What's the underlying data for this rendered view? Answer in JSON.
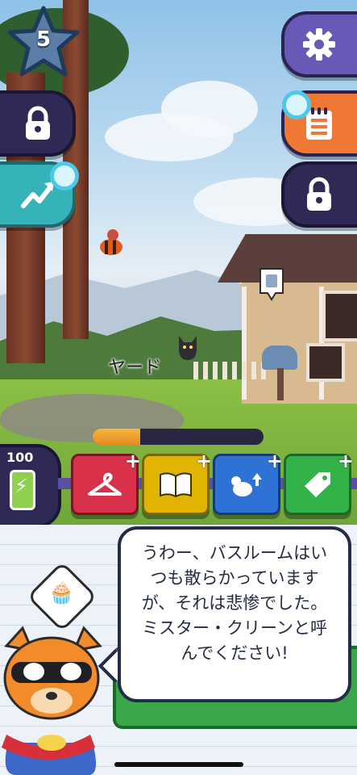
{
  "hud": {
    "level": "5",
    "energy": "100",
    "progress_fraction": 0.28
  },
  "scene": {
    "label": "ヤード"
  },
  "left_buttons": [
    {
      "icon": "lock-icon",
      "locked": true
    },
    {
      "icon": "trend-up-icon",
      "notification": true
    }
  ],
  "right_buttons": [
    {
      "icon": "gear-icon"
    },
    {
      "icon": "notepad-icon",
      "notification": true
    },
    {
      "icon": "lock-icon",
      "locked": true
    }
  ],
  "tools": [
    {
      "icon": "hanger-icon",
      "color": "#d9314a"
    },
    {
      "icon": "book-icon",
      "color": "#e0b400"
    },
    {
      "icon": "bird-upgrade-icon",
      "color": "#2f72d6"
    },
    {
      "icon": "tag-icon",
      "color": "#34b24a"
    }
  ],
  "dialog": {
    "text": "うわー、バスルームはいつも散らかっていますが、それは悲惨でした。ミスター・クリーンと呼んでください!"
  },
  "colors": {
    "navy": "#2f2955",
    "orange": "#f07834",
    "teal": "#36b3b8"
  }
}
